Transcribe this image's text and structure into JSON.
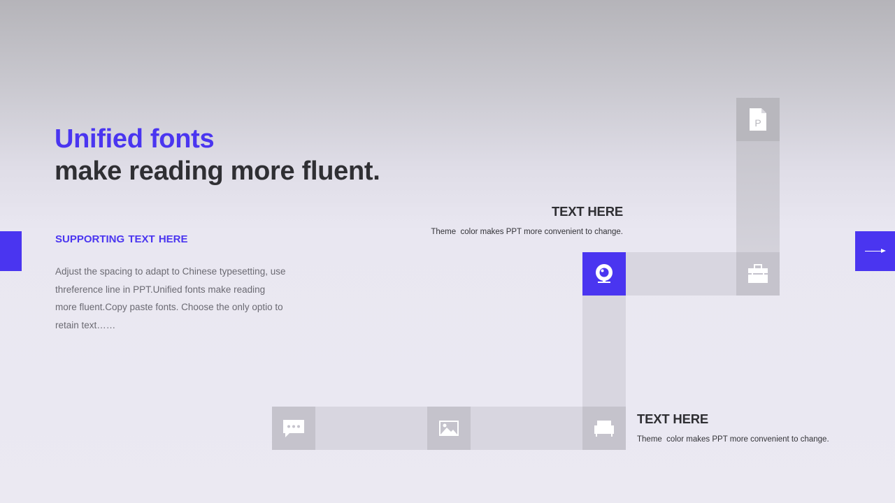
{
  "header": {
    "title_accent": "Unified fonts",
    "title_main": "make reading more fluent."
  },
  "left_panel": {
    "supporting_title": "SUPPORTING  TEXT HERE",
    "body": "Adjust the spacing to adapt to Chinese typesetting, use threference line in PPT.Unified fonts make reading more fluent.Copy paste fonts. Choose the only optio to retain text……"
  },
  "blocks": [
    {
      "heading": "TEXT HERE",
      "description": "Theme  color makes PPT more convenient to change."
    },
    {
      "heading": "TEXT HERE",
      "description": "Theme  color makes PPT more convenient to change."
    }
  ],
  "icons": {
    "top": "document-p-icon",
    "right": "briefcase-icon",
    "accent": "webcam-icon",
    "bottom_mid": "sofa-icon",
    "bottom_center": "image-icon",
    "bottom_left": "chat-bubble-icon",
    "next": "arrow-right-icon"
  },
  "colors": {
    "accent": "#4a35f0",
    "heading": "#2f2f33",
    "body": "#6b6a72",
    "bar": "#d8d6e0",
    "node": "#c5c3cc"
  }
}
